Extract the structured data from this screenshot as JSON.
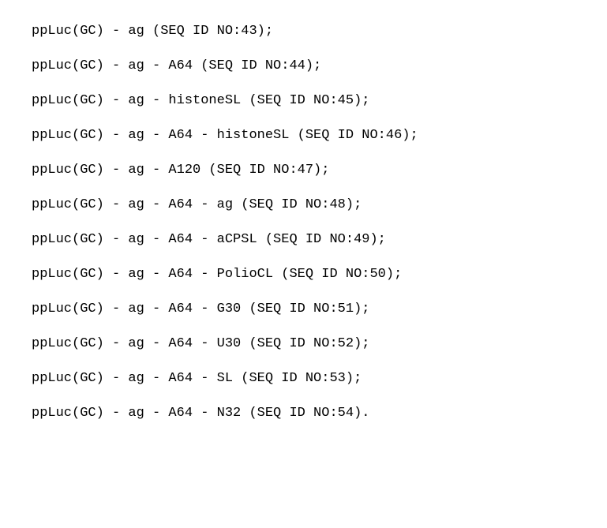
{
  "lines": [
    "ppLuc(GC) - ag (SEQ ID NO:43);",
    "ppLuc(GC) - ag - A64 (SEQ ID NO:44);",
    "ppLuc(GC) - ag - histoneSL (SEQ ID NO:45);",
    "ppLuc(GC) - ag - A64 - histoneSL (SEQ ID NO:46);",
    "ppLuc(GC) - ag - A120 (SEQ ID NO:47);",
    "ppLuc(GC) - ag - A64 - ag (SEQ ID NO:48);",
    "ppLuc(GC) - ag - A64 - aCPSL (SEQ ID NO:49);",
    "ppLuc(GC) - ag - A64 - PolioCL (SEQ ID NO:50);",
    "ppLuc(GC) - ag - A64 - G30 (SEQ ID NO:51);",
    "ppLuc(GC) - ag - A64 - U30 (SEQ ID NO:52);",
    "ppLuc(GC) - ag - A64 - SL (SEQ ID NO:53);",
    "ppLuc(GC) - ag - A64 - N32 (SEQ ID NO:54)."
  ]
}
